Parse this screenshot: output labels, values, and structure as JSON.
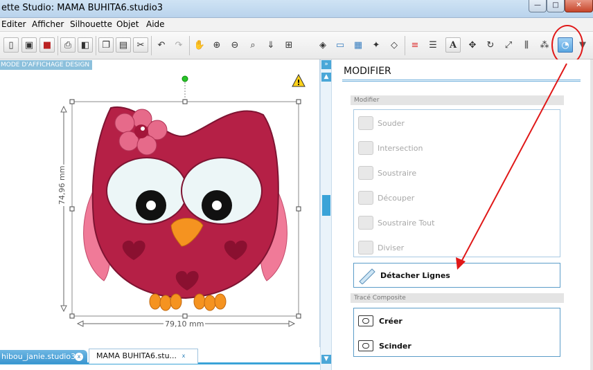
{
  "window": {
    "title": "ette Studio: MAMA BUHITA6.studio3",
    "buttons": {
      "minimize": "—",
      "maximize": "□",
      "close": "✕"
    }
  },
  "menu": [
    "Editer",
    "Afficher",
    "Silhouette",
    "Objet",
    "Aide"
  ],
  "toolbar": {
    "left_icons": [
      "new-document-icon",
      "save-icon",
      "save-library-icon",
      "print-icon",
      "send-to-silhouette-icon",
      "copy-icon",
      "paste-icon",
      "cut-icon",
      "undo-icon",
      "redo-icon",
      "pan-icon",
      "zoom-in-icon",
      "zoom-out-icon",
      "zoom-select-icon",
      "zoom-fit-page-icon",
      "zoom-fit-icon"
    ],
    "right_icons": [
      "fill-icon",
      "gradient-icon",
      "pattern-icon",
      "stroke-icon",
      "shadow-icon",
      "line-color-icon",
      "line-style-icon",
      "text-icon",
      "transform-icon",
      "rotate-icon",
      "scale-icon",
      "align-icon",
      "replicate-icon",
      "modify-icon",
      "panel-more-icon"
    ],
    "text_tool_glyph": "A"
  },
  "design": {
    "mode_label": "MODE D'AFFICHAGE DESIGN",
    "height_dimension": "74,96 mm",
    "width_dimension": "79,10 mm",
    "warning": "⚠"
  },
  "tabs": [
    {
      "label": "hibou_janie.studio3",
      "close": "x"
    },
    {
      "label": "MAMA BUHITA6.stu...",
      "close": "x"
    }
  ],
  "panel": {
    "title": "MODIFIER",
    "section_modify": "Modifier",
    "modify_items": [
      "Souder",
      "Intersection",
      "Soustraire",
      "Découper",
      "Soustraire Tout",
      "Diviser"
    ],
    "detach_lines": "Détacher Lignes",
    "section_compound": "Tracé Composite",
    "compound_items": [
      "Créer",
      "Scinder"
    ]
  },
  "colors": {
    "accent": "#3aa3d8",
    "annotation": "#e01818",
    "owl_body": "#b52046",
    "owl_wing": "#f07a98",
    "beak": "#f59320"
  }
}
